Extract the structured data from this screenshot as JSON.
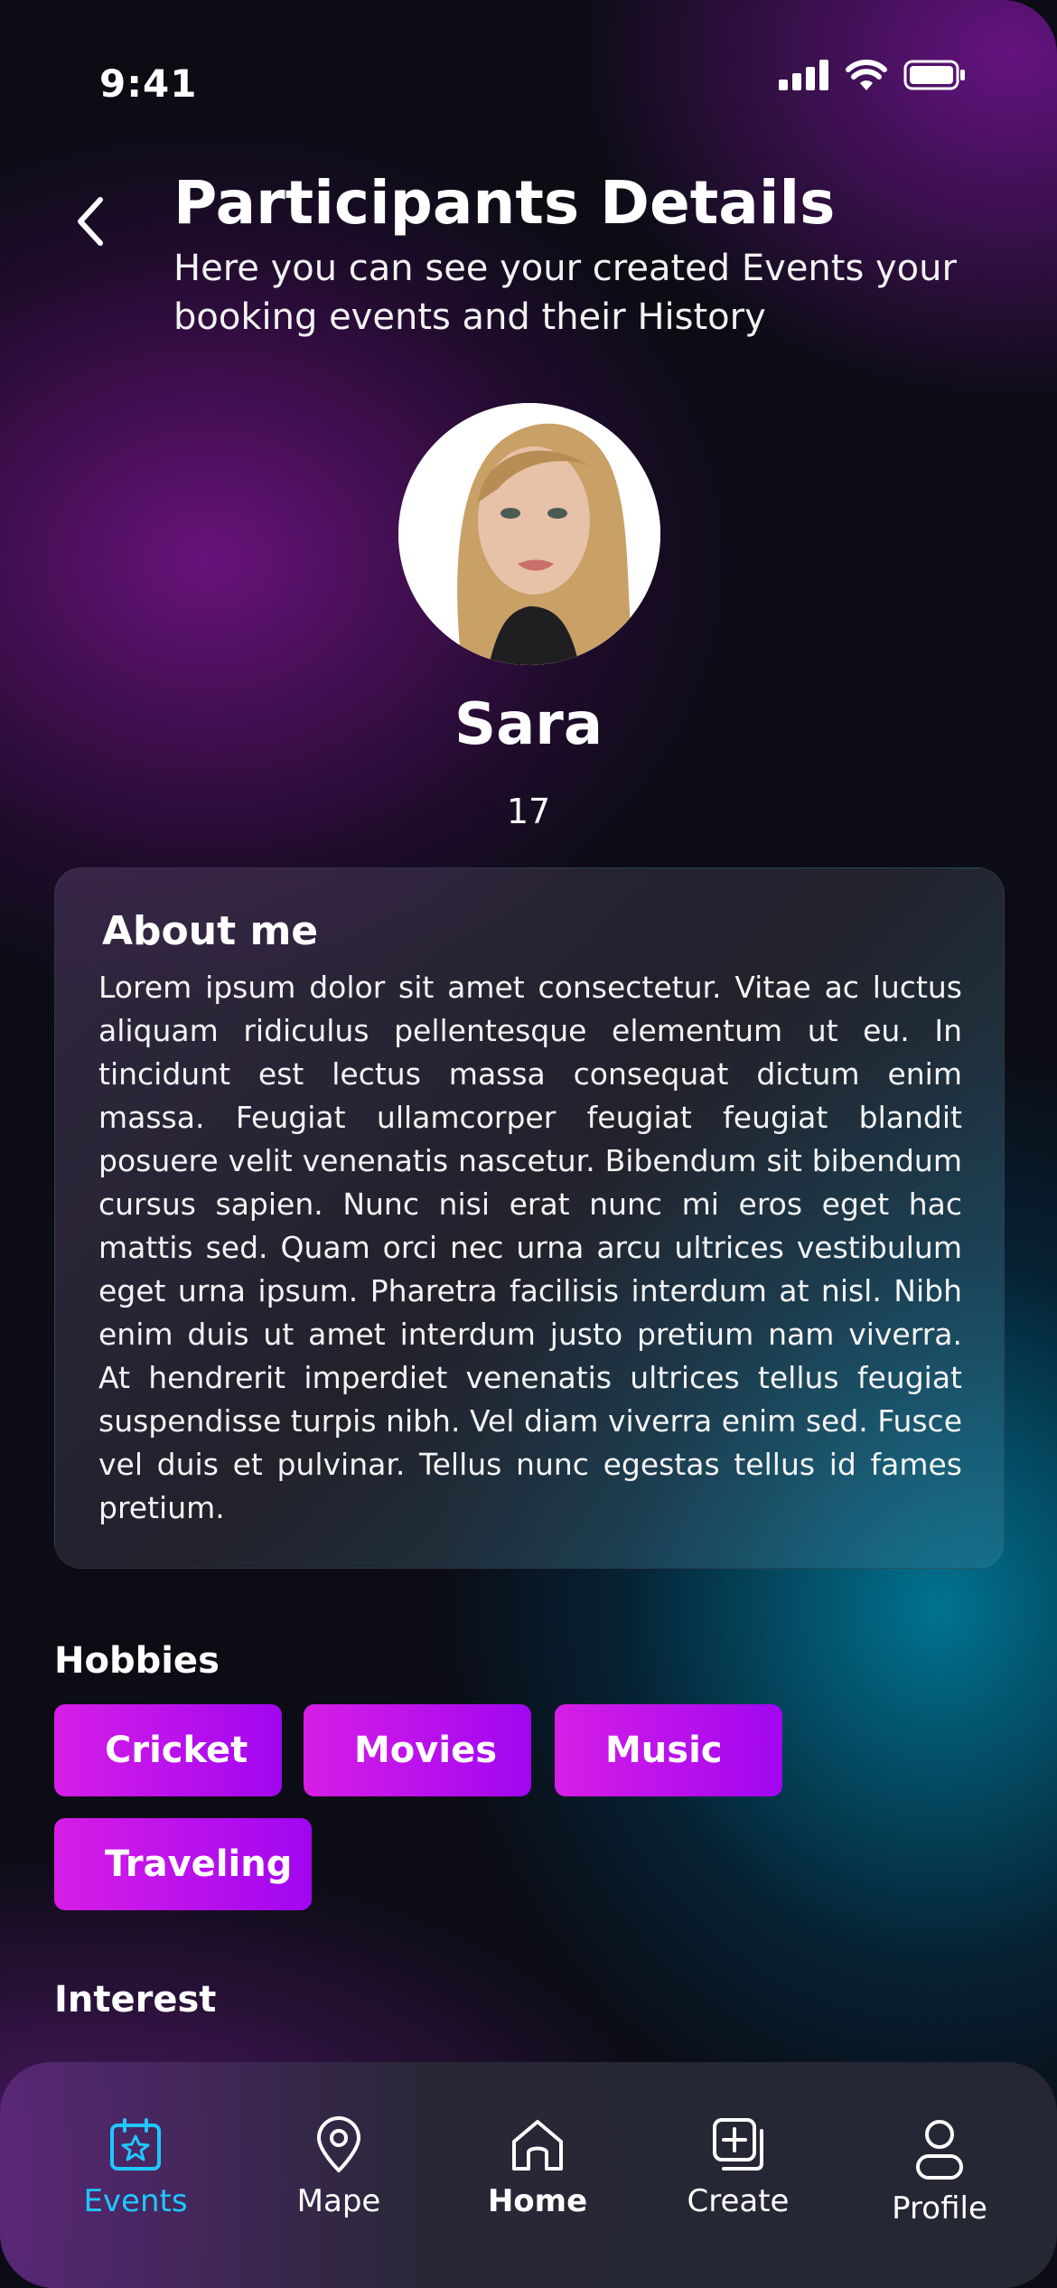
{
  "status_bar": {
    "time": "9:41"
  },
  "header": {
    "title": "Participants Details",
    "subtitle": "Here you can see your created Events your booking events and their History"
  },
  "profile": {
    "name": "Sara",
    "age": "17"
  },
  "about": {
    "title": "About me",
    "text": "Lorem ipsum dolor sit amet consectetur. Vitae ac luctus aliquam ridiculus pellentesque elementum ut eu. In tincidunt est lectus massa consequat dictum enim massa. Feugiat ullamcorper feugiat feugiat blandit posuere velit venenatis nascetur. Bibendum sit bibendum cursus sapien. Nunc nisi erat nunc mi eros eget hac mattis sed. Quam orci nec urna arcu ultrices vestibulum eget urna ipsum. Pharetra facilisis interdum at nisl. Nibh enim duis ut amet interdum justo pretium nam viverra. At hendrerit imperdiet venenatis ultrices tellus feugiat suspendisse turpis nibh. Vel diam viverra enim sed. Fusce vel duis et pulvinar. Tellus nunc egestas tellus id fames pretium."
  },
  "hobbies": {
    "label": "Hobbies",
    "items": [
      "Cricket",
      "Movies",
      "Music",
      "Traveling"
    ]
  },
  "interest": {
    "label": "Interest"
  },
  "nav": {
    "items": [
      {
        "label": "Events",
        "icon": "calendar-star-icon",
        "active": true
      },
      {
        "label": "Mape",
        "icon": "location-pin-icon",
        "active": false
      },
      {
        "label": "Home",
        "icon": "home-icon",
        "active": false
      },
      {
        "label": "Create",
        "icon": "add-square-icon",
        "active": false
      },
      {
        "label": "Profile",
        "icon": "user-icon",
        "active": false
      }
    ]
  },
  "colors": {
    "chip_gradient_start": "#d61ee6",
    "chip_gradient_end": "#a106f0",
    "active_nav": "#1ec8ff"
  }
}
